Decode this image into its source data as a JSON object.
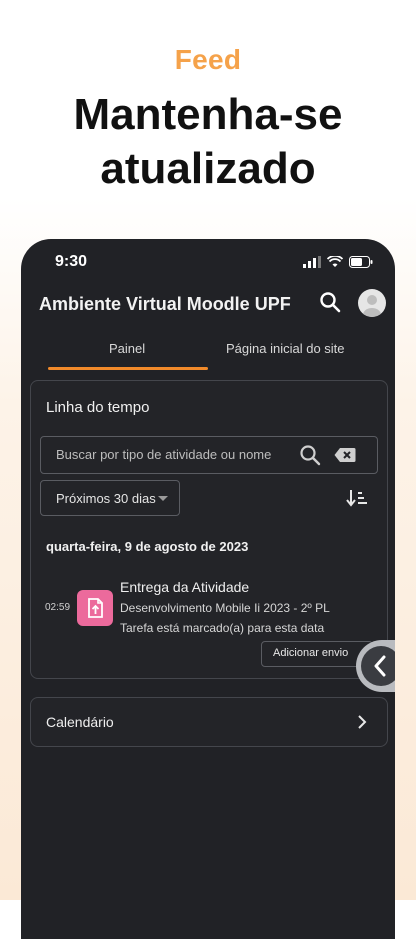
{
  "promo": {
    "eyebrow": "Feed",
    "title_line1": "Mantenha-se",
    "title_line2": "atualizado"
  },
  "status_bar": {
    "time": "9:30"
  },
  "app_bar": {
    "title": "Ambiente Virtual Moodle UPF"
  },
  "tabs": [
    {
      "label": "Painel",
      "active": true
    },
    {
      "label": "Página inicial do site",
      "active": false
    }
  ],
  "timeline": {
    "title": "Linha do tempo",
    "search_placeholder": "Buscar por tipo de atividade ou nome",
    "filter_selected": "Próximos 30 dias",
    "date_heading": "quarta-feira, 9 de agosto de 2023",
    "event": {
      "time": "02:59",
      "title": "Entrega da Atividade",
      "course": "Desenvolvimento Mobile Ii 2023 - 2º PL",
      "status": "Tarefa está marcado(a) para esta data",
      "action_label": "Adicionar envio",
      "icon": "assignment-upload-icon"
    }
  },
  "calendar": {
    "label": "Calendário"
  },
  "colors": {
    "accent": "#f18a2a",
    "promo_eyebrow": "#f5a24a",
    "event_icon_bg": "#ec6a9c",
    "surface": "#212226"
  }
}
